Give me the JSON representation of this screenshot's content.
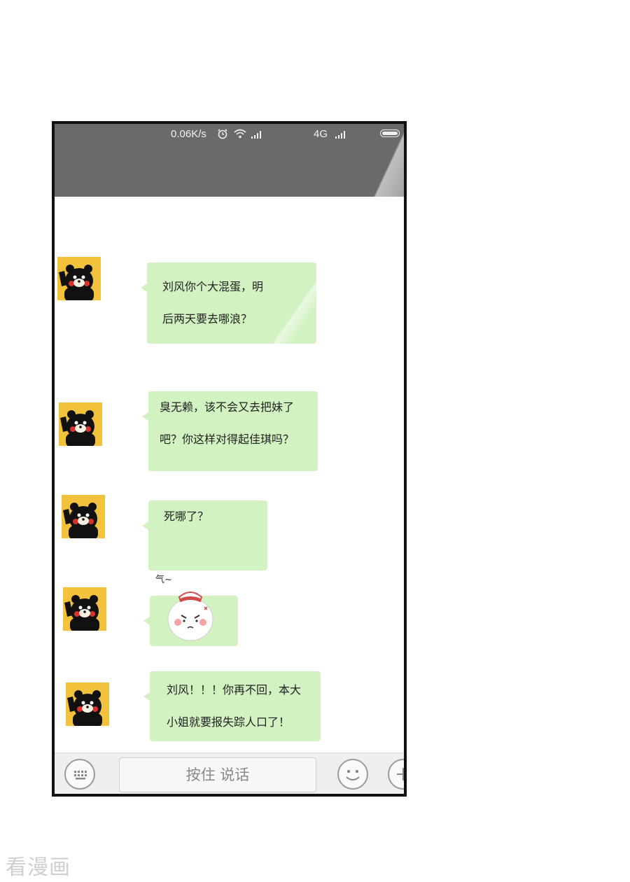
{
  "status_bar": {
    "speed": "0.06K/s",
    "network": "4G",
    "icons": [
      "alarm-icon",
      "wifi-icon",
      "signal-icon",
      "signal-icon",
      "battery-icon"
    ]
  },
  "messages": [
    {
      "sender_avatar": "kumamon-avatar",
      "lines": [
        "刘风你个大混蛋，明",
        "后两天要去哪浪？"
      ]
    },
    {
      "sender_avatar": "kumamon-avatar",
      "lines": [
        "臭无赖，该不会又去把妹了",
        "吧？你这样对得起佳琪吗？"
      ]
    },
    {
      "sender_avatar": "kumamon-avatar",
      "lines": [
        "死哪了？"
      ]
    },
    {
      "sender_avatar": "kumamon-avatar",
      "sticker_caption": "气~",
      "sticker": "angry-bun-sticker"
    },
    {
      "sender_avatar": "kumamon-avatar",
      "lines": [
        "刘风！！！你再不回，本大",
        "小姐就要报失踪人口了！"
      ]
    }
  ],
  "input_bar": {
    "talk_label": "按住 说话",
    "icons": [
      "keyboard-icon",
      "emoji-icon",
      "plus-icon"
    ]
  },
  "watermark": "看漫画",
  "colors": {
    "header": "#6a6a6c",
    "bubble": "#d2f2c2",
    "avatar_bg": "#f3c23c"
  }
}
